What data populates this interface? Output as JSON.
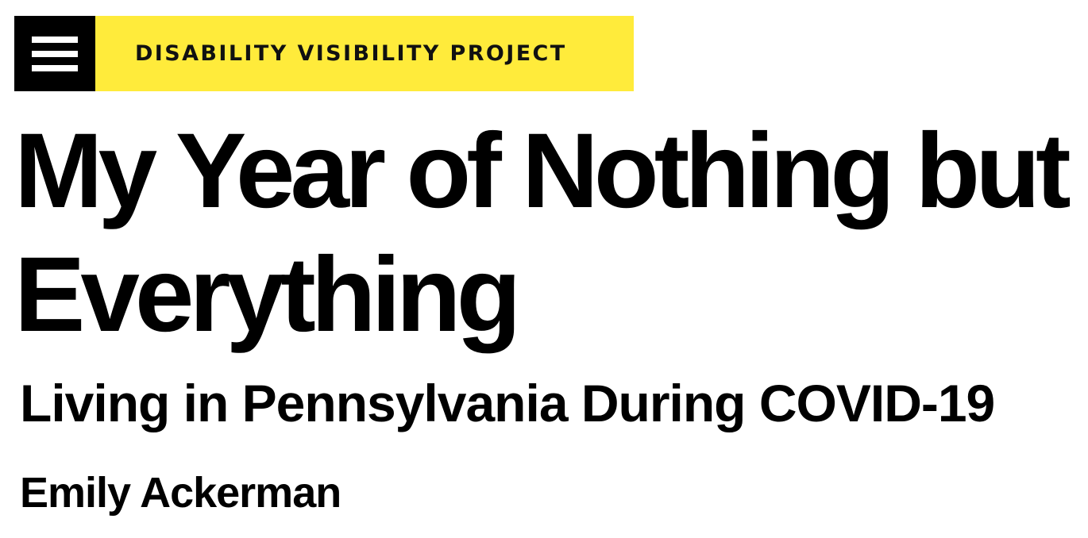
{
  "header": {
    "site_name": "DISABILITY VISIBILITY PROJECT",
    "menu_icon": "hamburger-menu-icon",
    "brand_color": "#ffeb3b",
    "menu_bg_color": "#000000"
  },
  "article": {
    "title": "My Year of Nothing but Everything",
    "subtitle": "Living in Pennsylvania During COVID-19",
    "author": "Emily Ackerman"
  }
}
